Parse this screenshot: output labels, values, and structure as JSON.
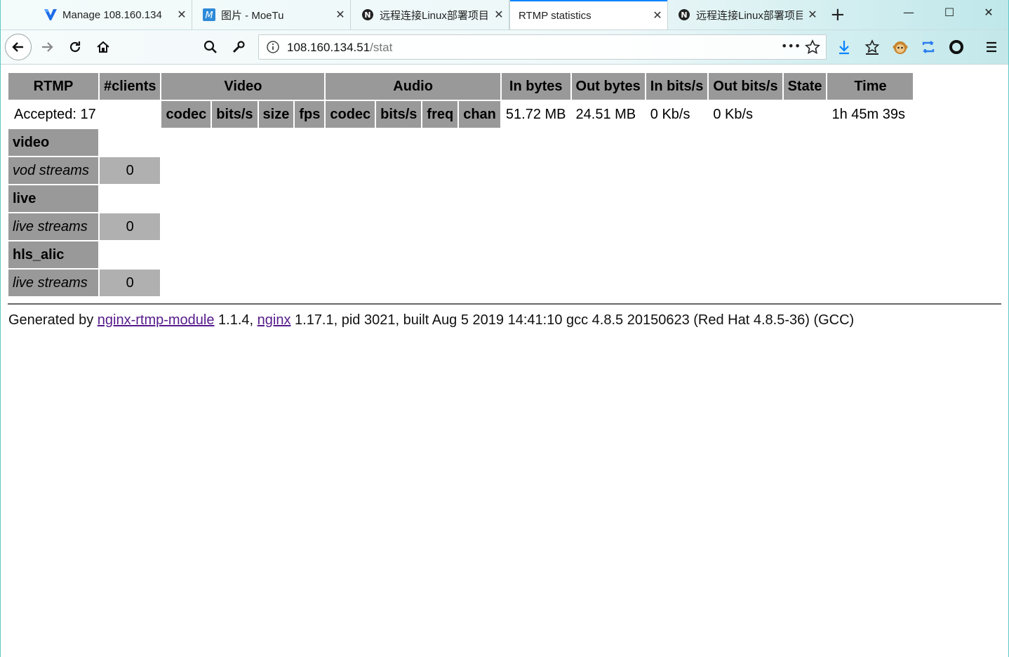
{
  "browser": {
    "tabs": [
      {
        "title": "Manage 108.160.134",
        "icon": "vultr-icon",
        "active": false
      },
      {
        "title": "图片 - MoeTu",
        "icon": "moetu-icon",
        "active": false
      },
      {
        "title": "远程连接Linux部署项目",
        "icon": "notion-icon",
        "active": false
      },
      {
        "title": "RTMP statistics",
        "icon": "",
        "active": true
      },
      {
        "title": "远程连接Linux部署项目",
        "icon": "notion-icon",
        "active": false
      }
    ],
    "close_glyph": "✕",
    "url_host": "108.160.134.51",
    "url_path": "/stat",
    "more_glyph": "•••"
  },
  "stat": {
    "headers": {
      "rtmp": "RTMP",
      "clients": "#clients",
      "video": "Video",
      "audio": "Audio",
      "in_bytes": "In bytes",
      "out_bytes": "Out bytes",
      "in_bits": "In bits/s",
      "out_bits": "Out bits/s",
      "state": "State",
      "time": "Time"
    },
    "sub_headers": {
      "v_codec": "codec",
      "v_bits": "bits/s",
      "v_size": "size",
      "v_fps": "fps",
      "a_codec": "codec",
      "a_bits": "bits/s",
      "a_freq": "freq",
      "a_chan": "chan"
    },
    "summary": {
      "accepted": "Accepted: 17",
      "in_bytes": "51.72 MB",
      "out_bytes": "24.51 MB",
      "in_bits": "0 Kb/s",
      "out_bits": "0 Kb/s",
      "time": "1h 45m 39s"
    },
    "apps": [
      {
        "name": "video",
        "stream_label": "vod streams",
        "count": "0"
      },
      {
        "name": "live",
        "stream_label": "live streams",
        "count": "0"
      },
      {
        "name": "hls_alic",
        "stream_label": "live streams",
        "count": "0"
      }
    ]
  },
  "footer": {
    "prefix": "Generated by ",
    "link1": "nginx-rtmp-module",
    "mid1": " 1.1.4, ",
    "link2": "nginx",
    "rest": " 1.17.1, pid 3021, built Aug 5 2019 14:41:10 gcc 4.8.5 20150623 (Red Hat 4.8.5-36) (GCC)"
  }
}
